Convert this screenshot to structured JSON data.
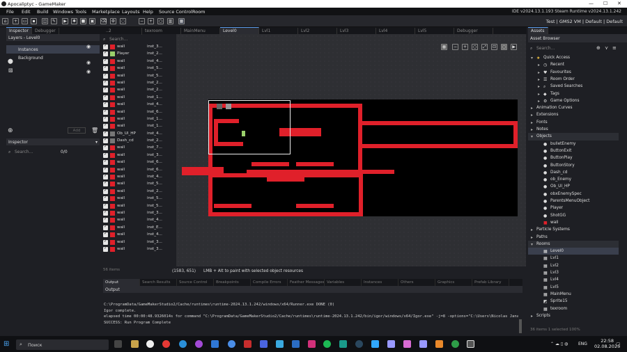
{
  "window": {
    "title": "Apocaliptyc - GameMaker",
    "controls": [
      "—",
      "☐",
      "✕"
    ]
  },
  "menu": [
    "File",
    "Edit",
    "Build",
    "Windows",
    "Tools",
    "Marketplace",
    "Layouts",
    "Help",
    "Source Control",
    "Room"
  ],
  "version": "IDE v2024.13.1.193 Steam  Runtime v2024.13.1.242",
  "target": "Test  |  GMS2 VM  |  Default  |  Default",
  "left_tabs": [
    "Inspector",
    "Debugger"
  ],
  "layers_header": "Layers - Level0",
  "layers": [
    "Instances",
    "Background"
  ],
  "add_label": "Add",
  "inspector_header": "Inspector",
  "search_placeholder": "Search...",
  "inspector_count": "0/0",
  "instance_search": "Search...",
  "instances": [
    {
      "name": "wall",
      "id": "inst_3..."
    },
    {
      "name": "Player",
      "id": "inst_2..."
    },
    {
      "name": "wall",
      "id": "inst_4..."
    },
    {
      "name": "wall",
      "id": "inst_5..."
    },
    {
      "name": "wall",
      "id": "inst_5..."
    },
    {
      "name": "wall",
      "id": "inst_2..."
    },
    {
      "name": "wall",
      "id": "inst_2..."
    },
    {
      "name": "wall",
      "id": "inst_1..."
    },
    {
      "name": "wall",
      "id": "inst_4..."
    },
    {
      "name": "wall",
      "id": "inst_6..."
    },
    {
      "name": "wall",
      "id": "inst_1..."
    },
    {
      "name": "wall",
      "id": "inst_1..."
    },
    {
      "name": "Ob_UI_HP",
      "id": "inst_4..."
    },
    {
      "name": "Dash_cd",
      "id": "inst_2..."
    },
    {
      "name": "wall",
      "id": "inst_7..."
    },
    {
      "name": "wall",
      "id": "inst_3..."
    },
    {
      "name": "wall",
      "id": "inst_6..."
    },
    {
      "name": "wall",
      "id": "inst_6..."
    },
    {
      "name": "wall",
      "id": "inst_4..."
    },
    {
      "name": "wall",
      "id": "inst_5..."
    },
    {
      "name": "wall",
      "id": "inst_2..."
    },
    {
      "name": "wall",
      "id": "inst_5..."
    },
    {
      "name": "wall",
      "id": "inst_5..."
    },
    {
      "name": "wall",
      "id": "inst_3..."
    },
    {
      "name": "wall",
      "id": "inst_4..."
    },
    {
      "name": "wall",
      "id": "inst_E..."
    },
    {
      "name": "wall",
      "id": "inst_4..."
    },
    {
      "name": "wall",
      "id": "inst_3..."
    },
    {
      "name": "wall",
      "id": "inst_3..."
    }
  ],
  "items_count": "56 items",
  "editor_tabs": [
    "..2",
    "texroom",
    "MainMenu",
    "Level0",
    "Lvl1",
    "Lvl2",
    "Lvl3",
    "Lvl4",
    "Lvl5",
    "Debugger"
  ],
  "editor_tab_active": "Level0",
  "status": {
    "coords": "(1583, 651)",
    "hint": "LMB + Alt to paint with selected object resources"
  },
  "assets": {
    "tab": "Assets",
    "browser": "Asset Browser",
    "search": "Search...",
    "items": [
      {
        "label": "Quick Access",
        "icon": "star-icon",
        "indent": 0,
        "open": true
      },
      {
        "label": "Recent",
        "icon": "clock-icon",
        "indent": 1
      },
      {
        "label": "Favourites",
        "icon": "heart-icon",
        "indent": 1
      },
      {
        "label": "Room Order",
        "icon": "list-icon",
        "indent": 1
      },
      {
        "label": "Saved Searches",
        "icon": "search-icon",
        "indent": 1
      },
      {
        "label": "Tags",
        "icon": "tag-icon",
        "indent": 1
      },
      {
        "label": "Game Options",
        "icon": "gear-icon",
        "indent": 1
      },
      {
        "label": "Animation Curves",
        "icon": "",
        "indent": 0
      },
      {
        "label": "Extensions",
        "icon": "",
        "indent": 0
      },
      {
        "label": "Fonts",
        "icon": "",
        "indent": 0
      },
      {
        "label": "Notes",
        "icon": "",
        "indent": 0
      },
      {
        "label": "Objects",
        "icon": "",
        "indent": 0,
        "open": true,
        "highlight": true
      },
      {
        "label": "bulletEnemy",
        "icon": "dot-icon",
        "indent": 1
      },
      {
        "label": "ButtonExit",
        "icon": "dot-icon",
        "indent": 1
      },
      {
        "label": "ButtonPlay",
        "icon": "dot-icon",
        "indent": 1
      },
      {
        "label": "ButtonStory",
        "icon": "dot-icon",
        "indent": 1
      },
      {
        "label": "Dash_cd",
        "icon": "dot-icon",
        "indent": 1
      },
      {
        "label": "ob_Enemy",
        "icon": "dot-icon",
        "indent": 1
      },
      {
        "label": "Ob_UI_HP",
        "icon": "dot-icon",
        "indent": 1
      },
      {
        "label": "obxEnemySpec",
        "icon": "dot-icon",
        "indent": 1
      },
      {
        "label": "ParentsMenuObject",
        "icon": "dot-icon",
        "indent": 1
      },
      {
        "label": "Player",
        "icon": "dot-icon",
        "indent": 1
      },
      {
        "label": "ShotGG",
        "icon": "dot-icon",
        "indent": 1
      },
      {
        "label": "wall",
        "icon": "red-square-icon",
        "indent": 1
      },
      {
        "label": "Particle Systems",
        "icon": "",
        "indent": 0
      },
      {
        "label": "Paths",
        "icon": "",
        "indent": 0
      },
      {
        "label": "Rooms",
        "icon": "",
        "indent": 0,
        "open": true,
        "highlight": true
      },
      {
        "label": "Level0",
        "icon": "room-icon",
        "indent": 1,
        "selected": true
      },
      {
        "label": "Lvl1",
        "icon": "room-icon",
        "indent": 1
      },
      {
        "label": "Lvl2",
        "icon": "room-icon",
        "indent": 1
      },
      {
        "label": "Lvl3",
        "icon": "room-icon",
        "indent": 1
      },
      {
        "label": "Lvl4",
        "icon": "room-icon",
        "indent": 1
      },
      {
        "label": "Lvl5",
        "icon": "room-icon",
        "indent": 1
      },
      {
        "label": "MainMenu",
        "icon": "room-icon",
        "indent": 1
      },
      {
        "label": "Sprite15",
        "icon": "sprite-icon",
        "indent": 1
      },
      {
        "label": "texroom",
        "icon": "room-icon",
        "indent": 1
      },
      {
        "label": "Scripts",
        "icon": "",
        "indent": 0
      }
    ],
    "footer": "36 items    1 selected    100%"
  },
  "output": {
    "tabs": [
      "Output",
      "Search Results",
      "Source Control",
      "Breakpoints",
      "Compile Errors",
      "Feather Messages",
      "Variables",
      "Instances",
      "Others",
      "Graphics",
      "Prefab Library"
    ],
    "header": "Output",
    "lines": [
      "C:\\ProgramData/GameMakerStudio2/Cache/runtimes\\runtime-2024.13.1.242/windows/x64/Runner.exe DONE (0)",
      "Igor complete.",
      "elapsed time 00:00:48.9326014s for command \"C:\\ProgramData/GameMakerStudio2/Cache/runtimes\\runtime-2024.13.1.242/bin/igor/windows/x64/Igor.exe\" -j=8  -options=\"C:\\Users\\Nicolas Jana",
      "SUCCESS: Run Program Complete"
    ]
  },
  "taskbar": {
    "search": "Поиск",
    "lang": "ENG",
    "time": "22:58",
    "date": "02.08.2025"
  },
  "colors": {
    "wall": "#e0202a",
    "room_bg": "#000000",
    "accent": "#5c9ded"
  }
}
